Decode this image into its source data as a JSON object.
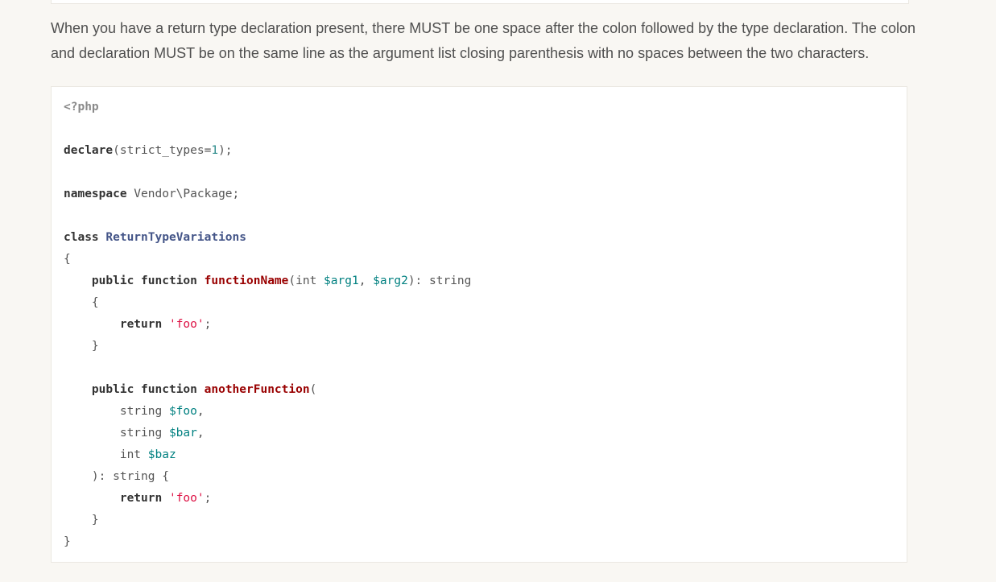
{
  "paragraph": "When you have a return type declaration present, there MUST be one space after the colon followed by the type declaration. The colon and declaration MUST be on the same line as the argument list closing parenthesis with no spaces between the two characters.",
  "code_lines": [
    [
      {
        "t": "<?php",
        "c": "tag"
      }
    ],
    [],
    [
      {
        "t": "declare",
        "c": "kw"
      },
      {
        "t": "(strict_types=",
        "c": "plain"
      },
      {
        "t": "1",
        "c": "num"
      },
      {
        "t": ");",
        "c": "plain"
      }
    ],
    [],
    [
      {
        "t": "namespace",
        "c": "kw"
      },
      {
        "t": " Vendor\\Package;",
        "c": "plain"
      }
    ],
    [],
    [
      {
        "t": "class",
        "c": "kw"
      },
      {
        "t": " ",
        "c": "plain"
      },
      {
        "t": "ReturnTypeVariations",
        "c": "cls"
      }
    ],
    [
      {
        "t": "{",
        "c": "plain"
      }
    ],
    [
      {
        "t": "    ",
        "c": "plain"
      },
      {
        "t": "public",
        "c": "kw"
      },
      {
        "t": " ",
        "c": "plain"
      },
      {
        "t": "function",
        "c": "kw"
      },
      {
        "t": " ",
        "c": "plain"
      },
      {
        "t": "functionName",
        "c": "fn"
      },
      {
        "t": "(int ",
        "c": "plain"
      },
      {
        "t": "$arg1",
        "c": "var"
      },
      {
        "t": ", ",
        "c": "plain"
      },
      {
        "t": "$arg2",
        "c": "var"
      },
      {
        "t": "): string",
        "c": "plain"
      }
    ],
    [
      {
        "t": "    {",
        "c": "plain"
      }
    ],
    [
      {
        "t": "        ",
        "c": "plain"
      },
      {
        "t": "return",
        "c": "kw"
      },
      {
        "t": " ",
        "c": "plain"
      },
      {
        "t": "'foo'",
        "c": "str"
      },
      {
        "t": ";",
        "c": "plain"
      }
    ],
    [
      {
        "t": "    }",
        "c": "plain"
      }
    ],
    [],
    [
      {
        "t": "    ",
        "c": "plain"
      },
      {
        "t": "public",
        "c": "kw"
      },
      {
        "t": " ",
        "c": "plain"
      },
      {
        "t": "function",
        "c": "kw"
      },
      {
        "t": " ",
        "c": "plain"
      },
      {
        "t": "anotherFunction",
        "c": "fn"
      },
      {
        "t": "(",
        "c": "plain"
      }
    ],
    [
      {
        "t": "        string ",
        "c": "plain"
      },
      {
        "t": "$foo",
        "c": "var"
      },
      {
        "t": ",",
        "c": "plain"
      }
    ],
    [
      {
        "t": "        string ",
        "c": "plain"
      },
      {
        "t": "$bar",
        "c": "var"
      },
      {
        "t": ",",
        "c": "plain"
      }
    ],
    [
      {
        "t": "        int ",
        "c": "plain"
      },
      {
        "t": "$baz",
        "c": "var"
      }
    ],
    [
      {
        "t": "    ): string {",
        "c": "plain"
      }
    ],
    [
      {
        "t": "        ",
        "c": "plain"
      },
      {
        "t": "return",
        "c": "kw"
      },
      {
        "t": " ",
        "c": "plain"
      },
      {
        "t": "'foo'",
        "c": "str"
      },
      {
        "t": ";",
        "c": "plain"
      }
    ],
    [
      {
        "t": "    }",
        "c": "plain"
      }
    ],
    [
      {
        "t": "}",
        "c": "plain"
      }
    ]
  ]
}
